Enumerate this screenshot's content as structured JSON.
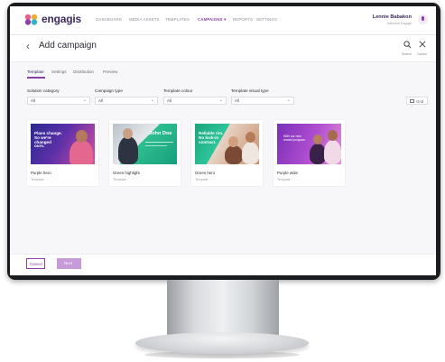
{
  "app": {
    "brand": "engagis"
  },
  "nav": {
    "items": [
      {
        "label": "DASHBOARD"
      },
      {
        "label": "MEDIA ASSETS"
      },
      {
        "label": "TEMPLATES"
      },
      {
        "label": "CAMPAIGNS ▾",
        "active": true
      },
      {
        "label": "REPORTS"
      },
      {
        "label": "SETTINGS"
      }
    ]
  },
  "user": {
    "name": "Lennie Babakon",
    "org": "Intersect Engage"
  },
  "header": {
    "back_icon": "chevron-left-icon",
    "title": "Add campaign",
    "actions": [
      {
        "icon": "search-icon",
        "label": "Search"
      },
      {
        "icon": "close-icon",
        "label": "Cancel"
      }
    ]
  },
  "tabs": [
    {
      "label": "Template",
      "active": true
    },
    {
      "label": "Settings"
    },
    {
      "label": "Distribution"
    },
    {
      "label": "Preview"
    }
  ],
  "filters": [
    {
      "label": "Solution category",
      "value": "All"
    },
    {
      "label": "Campaign type",
      "value": "All"
    },
    {
      "label": "Template colour",
      "value": "All"
    },
    {
      "label": "Template visual type",
      "value": "All"
    }
  ],
  "view_toggle": {
    "label": "Grid",
    "icon": "grid-icon"
  },
  "templates": [
    {
      "title": "Purple hero",
      "subtitle": "Template",
      "thumb_text": "Plans change.\nSo we're changed\nours.",
      "accent": "#3a2a8c"
    },
    {
      "title": "Green highlight",
      "subtitle": "Template",
      "thumb_text": "John Doe",
      "accent": "#1f9e7a"
    },
    {
      "title": "Green hero",
      "subtitle": "Template",
      "thumb_text": "Reliable rim.\nNo lock-in\ncontract.",
      "accent": "#21b08a"
    },
    {
      "title": "Purple wide",
      "subtitle": "Template",
      "thumb_text": "With our new\nreward program",
      "accent": "#a244c8"
    }
  ],
  "footer": {
    "cancel_label": "Cancel",
    "next_label": "Next"
  },
  "colors": {
    "accent": "#8b3fa8",
    "next_disabled": "#c79bd9",
    "bezel": "#1b1c1f"
  }
}
